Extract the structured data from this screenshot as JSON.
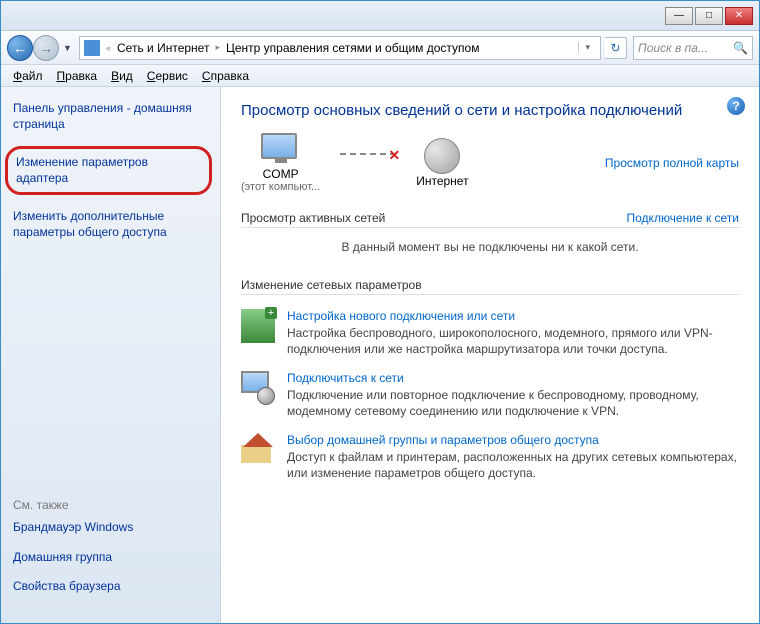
{
  "titlebar": {
    "min": "—",
    "max": "□",
    "close": "✕"
  },
  "nav": {
    "back": "←",
    "fwd": "→",
    "bc1": "Сеть и Интернет",
    "bc2": "Центр управления сетями и общим доступом",
    "search_placeholder": "Поиск в па..."
  },
  "menu": {
    "file": "Файл",
    "edit": "Правка",
    "view": "Вид",
    "service": "Сервис",
    "help": "Справка",
    "file_u": "Ф",
    "edit_u": "П",
    "view_u": "В",
    "service_u": "С",
    "help_u": "С"
  },
  "sidebar": {
    "home": "Панель управления - домашняя страница",
    "adapter": "Изменение параметров адаптера",
    "sharing": "Изменить дополнительные параметры общего доступа",
    "seealso": "См. также",
    "firewall": "Брандмауэр Windows",
    "homegroup": "Домашняя группа",
    "browser": "Свойства браузера"
  },
  "main": {
    "heading": "Просмотр основных сведений о сети и настройка подключений",
    "full_map": "Просмотр полной карты",
    "comp": "COMP",
    "comp_sub": "(этот компьют...",
    "internet": "Интернет",
    "active_title": "Просмотр активных сетей",
    "active_link": "Подключение к сети",
    "active_msg": "В данный момент вы не подключены ни к какой сети.",
    "change_title": "Изменение сетевых параметров",
    "tasks": [
      {
        "title": "Настройка нового подключения или сети",
        "desc": "Настройка беспроводного, широкополосного, модемного, прямого или VPN-подключения или же настройка маршрутизатора или точки доступа."
      },
      {
        "title": "Подключиться к сети",
        "desc": "Подключение или повторное подключение к беспроводному, проводному, модемному сетевому соединению или подключение к VPN."
      },
      {
        "title": "Выбор домашней группы и параметров общего доступа",
        "desc": "Доступ к файлам и принтерам, расположенных на других сетевых компьютерах, или изменение параметров общего доступа."
      }
    ]
  }
}
